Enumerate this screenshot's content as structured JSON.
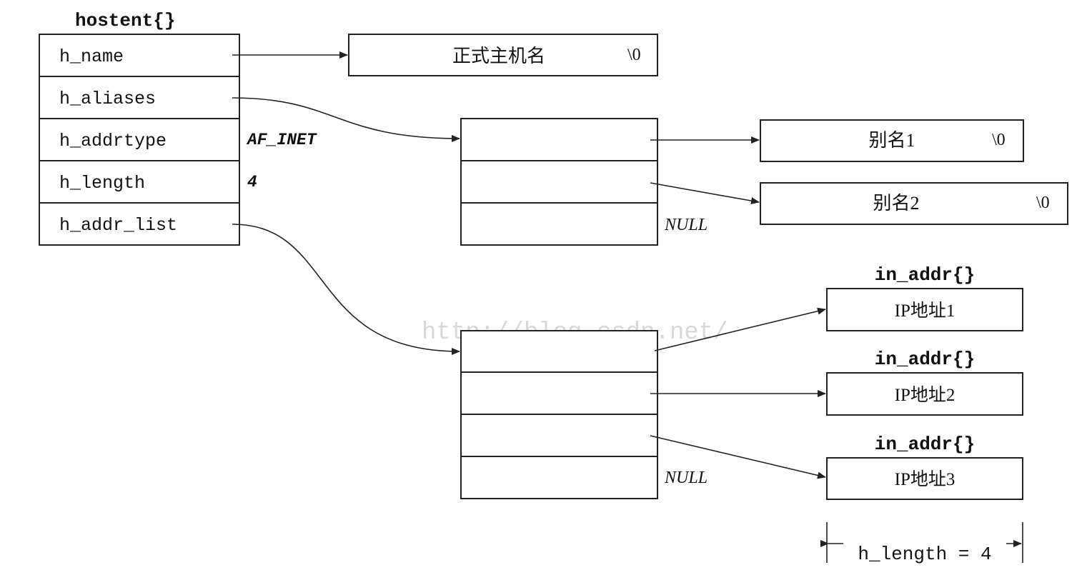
{
  "hostent": {
    "title": "hostent{}",
    "fields": [
      "h_name",
      "h_aliases",
      "h_addrtype",
      "h_length",
      "h_addr_list"
    ],
    "addrtype_value": "AF_INET",
    "length_value": "4"
  },
  "official_name": {
    "label": "正式主机名",
    "terminator": "\\0"
  },
  "aliases": {
    "items": [
      {
        "label": "别名1",
        "terminator": "\\0"
      },
      {
        "label": "别名2",
        "terminator": "\\0"
      }
    ],
    "null_label": "NULL"
  },
  "addr_list": {
    "null_label": "NULL",
    "struct_title": "in_addr{}",
    "items": [
      "IP地址1",
      "IP地址2",
      "IP地址3"
    ]
  },
  "length_dimension": "h_length = 4",
  "watermark": "http://blog.csdn.net/"
}
